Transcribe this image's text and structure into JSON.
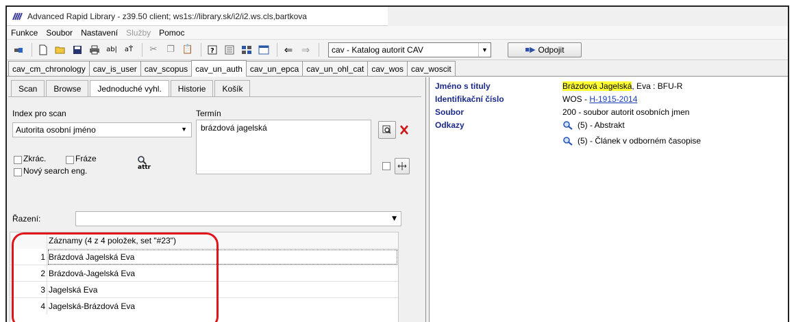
{
  "window": {
    "title": "Advanced Rapid Library - z39.50 client; ws1s://library.sk/i2/i2.ws.cls,bartkova"
  },
  "menu": {
    "items": [
      "Funkce",
      "Soubor",
      "Nastavení",
      "Služby",
      "Pomoc"
    ]
  },
  "toolbar": {
    "db_select_value": "cav - Katalog autorit CAV",
    "disconnect_label": "Odpojit"
  },
  "db_tabs": [
    "cav_cm_chronology",
    "cav_is_user",
    "cav_scopus",
    "cav_un_auth",
    "cav_un_epca",
    "cav_un_ohl_cat",
    "cav_wos",
    "cav_woscit"
  ],
  "active_db_tab": "cav_un_auth",
  "search": {
    "tabs": [
      "Scan",
      "Browse",
      "Jednoduché vyhl.",
      "Historie",
      "Košík"
    ],
    "index_label": "Index pro scan",
    "term_label": "Termín",
    "index_value": "Autorita osobní jméno",
    "term_value": "brázdová jagelská",
    "opt_abbrev": "Zkrác.",
    "opt_phrase": "Fráze",
    "opt_new_engine": "Nový search eng.",
    "attr_label": "attr",
    "sort_label": "Řazení:"
  },
  "results": {
    "header": "Záznamy (4 z 4 položek, set \"#23\")",
    "rows": [
      {
        "num": "1",
        "text": "Brázdová Jagelská Eva"
      },
      {
        "num": "2",
        "text": "Brázdová-Jagelská Eva"
      },
      {
        "num": "3",
        "text": "Jagelská Eva"
      },
      {
        "num": "4",
        "text": "Jagelská-Brázdová Eva"
      }
    ]
  },
  "detail": {
    "name_key": "Jméno s tituly",
    "name_hl": "Brázdová Jagelská",
    "name_rest": ", Eva : BFU-R",
    "id_key": "Identifikační číslo",
    "id_prefix": "WOS - ",
    "id_link": "H-1915-2014",
    "file_key": "Soubor",
    "file_value": "200 - soubor autorit osobních jmen",
    "refs_key": "Odkazy",
    "refs": [
      "(5) - Abstrakt",
      "(5) - Článek v odborném časopise"
    ]
  },
  "colors": {
    "label_blue": "#1b2a8a",
    "highlight_yellow": "#ffff33",
    "annotation_red": "#e1141b"
  }
}
